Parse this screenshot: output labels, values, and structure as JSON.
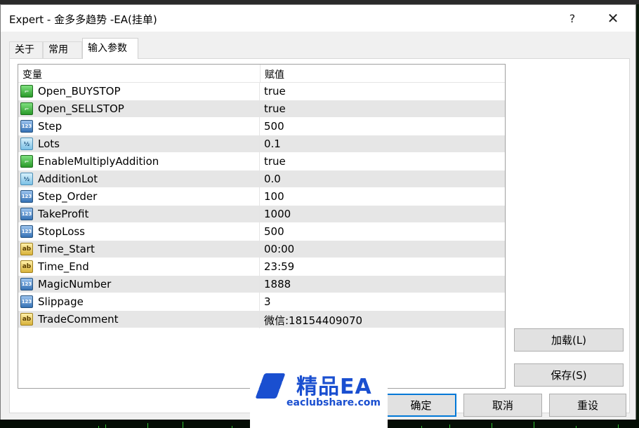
{
  "window": {
    "title": "Expert - 金多多趋势 -EA(挂单)",
    "help_label": "?",
    "close_label": "✕"
  },
  "tabs": [
    {
      "label": "关于",
      "active": false
    },
    {
      "label": "常用",
      "active": false
    },
    {
      "label": "输入参数",
      "active": true
    }
  ],
  "table": {
    "headers": {
      "variable": "变量",
      "value": "赋值"
    },
    "rows": [
      {
        "type": "bool",
        "icon": "bool-icon",
        "name": "Open_BUYSTOP",
        "value": "true"
      },
      {
        "type": "bool",
        "icon": "bool-icon",
        "name": "Open_SELLSTOP",
        "value": "true"
      },
      {
        "type": "int",
        "icon": "integer-icon",
        "name": "Step",
        "value": "500"
      },
      {
        "type": "dbl",
        "icon": "double-icon",
        "name": "Lots",
        "value": "0.1"
      },
      {
        "type": "bool",
        "icon": "bool-icon",
        "name": "EnableMultiplyAddition",
        "value": "true"
      },
      {
        "type": "dbl",
        "icon": "double-icon",
        "name": "AdditionLot",
        "value": "0.0"
      },
      {
        "type": "int",
        "icon": "integer-icon",
        "name": "Step_Order",
        "value": "100"
      },
      {
        "type": "int",
        "icon": "integer-icon",
        "name": "TakeProfit",
        "value": "1000"
      },
      {
        "type": "int",
        "icon": "integer-icon",
        "name": "StopLoss",
        "value": "500"
      },
      {
        "type": "str",
        "icon": "string-icon",
        "name": "Time_Start",
        "value": "00:00"
      },
      {
        "type": "str",
        "icon": "string-icon",
        "name": "Time_End",
        "value": "23:59"
      },
      {
        "type": "int",
        "icon": "integer-icon",
        "name": "MagicNumber",
        "value": "1888"
      },
      {
        "type": "int",
        "icon": "integer-icon",
        "name": "Slippage",
        "value": "3"
      },
      {
        "type": "str",
        "icon": "string-icon",
        "name": "TradeComment",
        "value": "微信:18154409070"
      }
    ]
  },
  "icon_glyphs": {
    "bool": "⌐",
    "int": "123",
    "dbl": "½",
    "str": "ab"
  },
  "buttons": {
    "load": "加载(L)",
    "save": "保存(S)",
    "ok": "确定",
    "cancel": "取消",
    "reset": "重设"
  },
  "watermark": {
    "title": "精品EA",
    "subtitle": "eaclubshare.com"
  },
  "colors": {
    "accent": "#0078d7",
    "watermark_blue": "#1a4fd0"
  }
}
